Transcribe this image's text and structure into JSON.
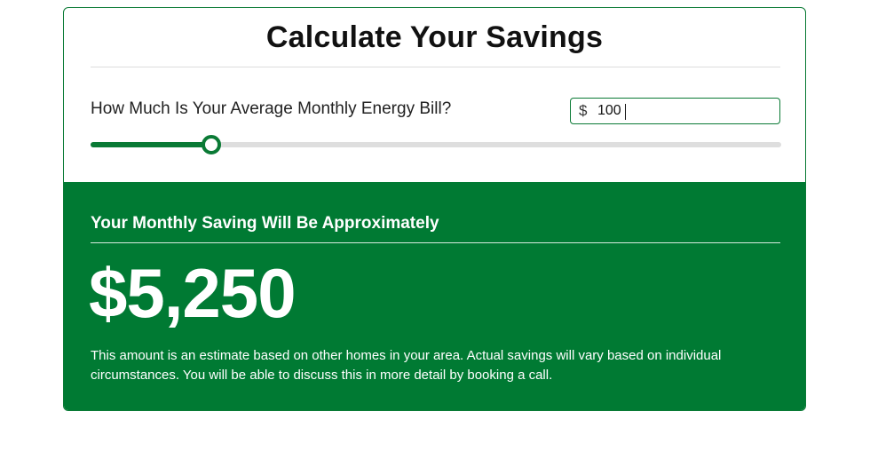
{
  "calculator": {
    "title": "Calculate Your Savings",
    "question": "How Much Is Your Average Monthly Energy Bill?",
    "currency_symbol": "$",
    "bill_value": "100",
    "slider_fraction": 0.175
  },
  "result": {
    "heading": "Your Monthly Saving Will Be Approximately",
    "amount": "$5,250",
    "disclaimer": "This amount is an estimate based on other homes in your area. Actual savings will vary based on individual circumstances. You will be able to discuss this in more detail by booking a call."
  },
  "colors": {
    "brand_green": "#007a33",
    "track_gray": "#dedede"
  }
}
